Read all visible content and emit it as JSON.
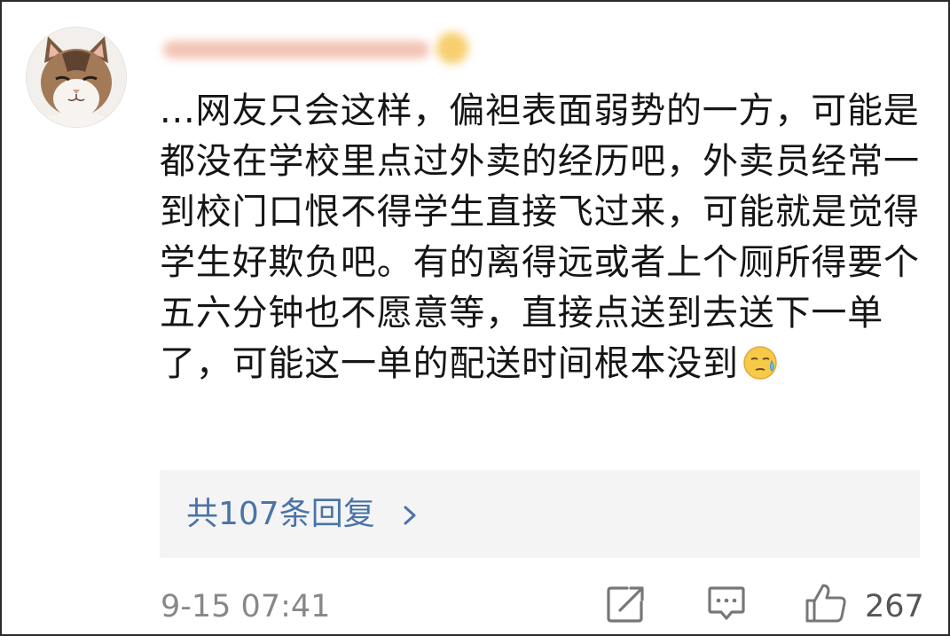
{
  "comment": {
    "text": "...网友只会这样，偏袒表面弱势的一方，可能是都没在学校里点过外卖的经历吧，外卖员经常一到校门口恨不得学生直接飞过来，可能就是觉得学生好欺负吧。有的离得远或者上个厕所得要个五六分钟也不愿意等，直接点送到去送下一单了，可能这一单的配送时间根本没到",
    "emoji": "sweat-emoji"
  },
  "replies": {
    "label": "共107条回复",
    "chevron_icon": "chevron-right-icon"
  },
  "footer": {
    "timestamp": "9-15 07:41",
    "share_icon": "share-icon",
    "reply_icon": "comment-icon",
    "like_icon": "thumbs-up-icon",
    "like_count": "267"
  },
  "colors": {
    "link_blue": "#4a74a8",
    "reply_box_bg": "#f4f4f4",
    "meta_gray": "#888888",
    "text": "#151515"
  }
}
